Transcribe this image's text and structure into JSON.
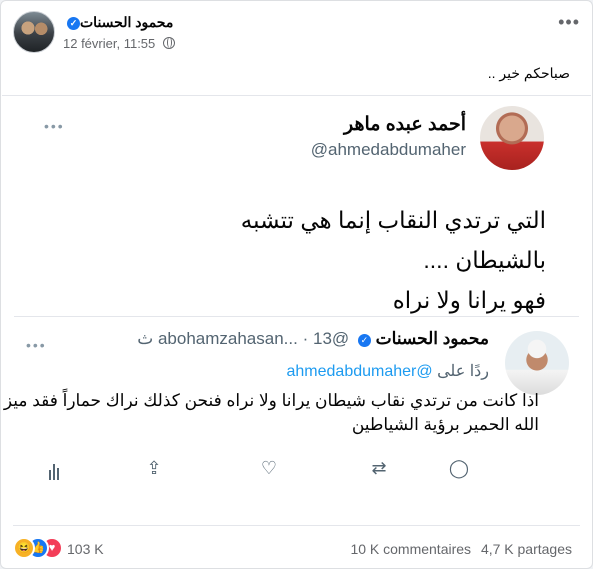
{
  "post": {
    "author": "محمود الحسنات",
    "date": "12 février, 11:55",
    "privacy_icon": "globe-icon",
    "text": "صباحكم خير .."
  },
  "tweet": {
    "name": "أحمد عبده ماهر",
    "handle": "@ahmedabdumaher",
    "lines": [
      "التي ترتدي النقاب إنما هي تتشبه",
      "بالشيطان ....",
      "فهو يرانا ولا نراه"
    ]
  },
  "quote": {
    "name": "محمود الحسنات",
    "handle": "@abohamzahasan...",
    "time": "13 ث",
    "reply_prefix": "ردًا على",
    "reply_handle": "@ahmedabdumaher",
    "text": "اذا كانت من ترتدي نقاب شيطان يرانا ولا نراه فنحن كذلك نراك حماراً فقد ميز الله الحمير برؤية الشياطين"
  },
  "footer": {
    "reactions_count": "103 K",
    "comments": "10 K commentaires",
    "shares": "4,7 K partages"
  },
  "colors": {
    "facebook_blue": "#1877f2",
    "twitter_blue": "#1d9bf0",
    "love": "#f33e58",
    "haha": "#f7b125"
  }
}
